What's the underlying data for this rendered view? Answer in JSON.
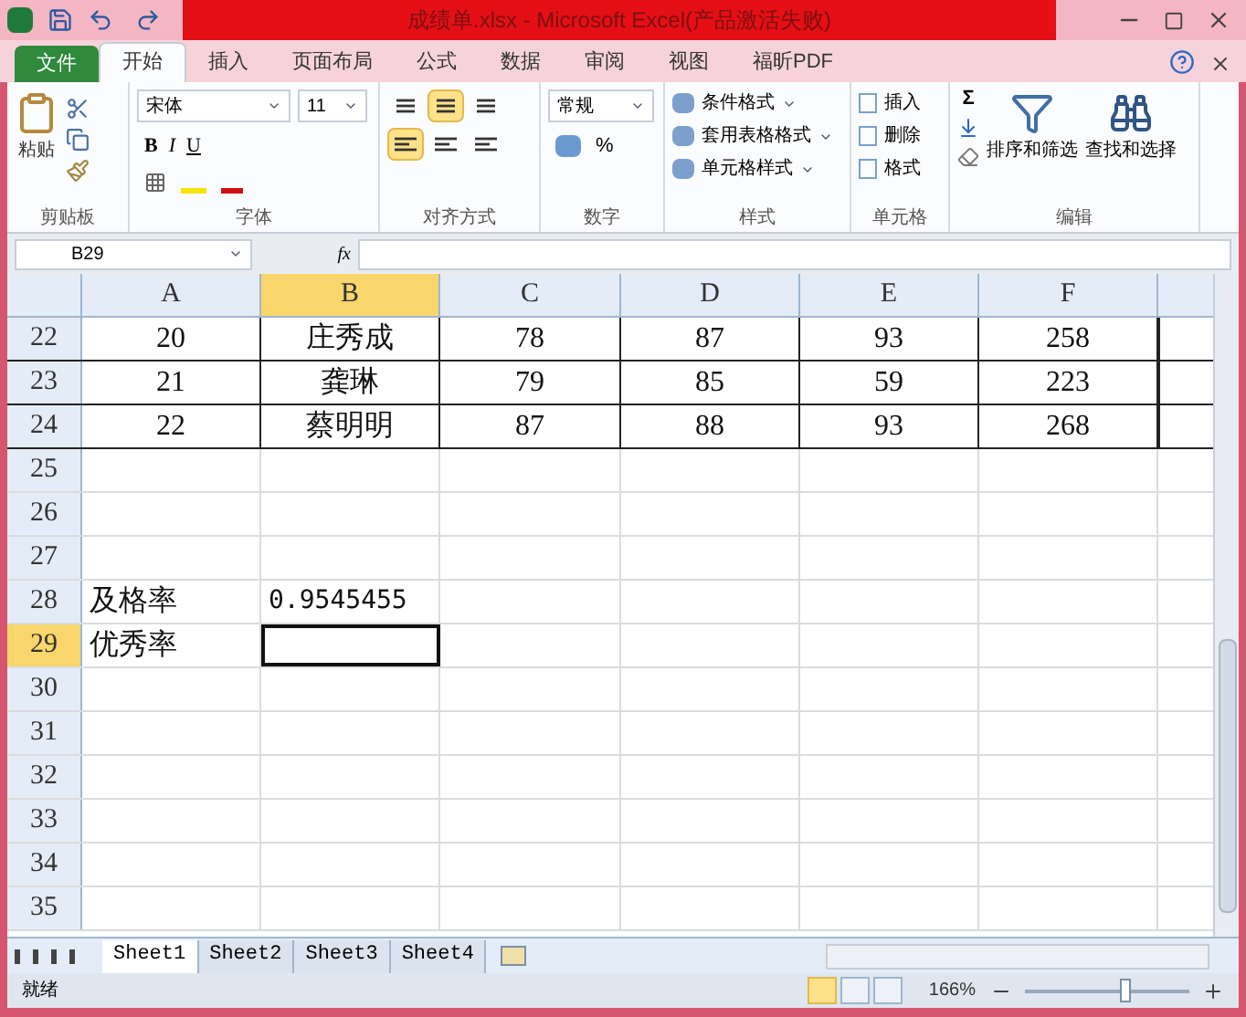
{
  "window": {
    "title": "成绩单.xlsx - Microsoft Excel(产品激活失败)"
  },
  "file_tab": "文件",
  "tabs": [
    {
      "label": "开始",
      "selected": true
    },
    {
      "label": "插入",
      "selected": false
    },
    {
      "label": "页面布局",
      "selected": false
    },
    {
      "label": "公式",
      "selected": false
    },
    {
      "label": "数据",
      "selected": false
    },
    {
      "label": "审阅",
      "selected": false
    },
    {
      "label": "视图",
      "selected": false
    },
    {
      "label": "福昕PDF",
      "selected": false
    }
  ],
  "ribbon": {
    "clipboard": {
      "label": "剪贴板",
      "paste": "粘贴"
    },
    "font": {
      "label": "字体",
      "font_name": "宋体",
      "font_size": "11",
      "bold": "B",
      "italic": "I",
      "underline": "U"
    },
    "alignment": {
      "label": "对齐方式",
      "vertical": [
        {
          "selected": false
        },
        {
          "selected": true
        },
        {
          "selected": false
        }
      ],
      "horizontal": [
        {
          "selected": true
        },
        {
          "selected": false
        },
        {
          "selected": false
        }
      ]
    },
    "number": {
      "label": "数字",
      "format": "常规",
      "percent": "%"
    },
    "styles": {
      "label": "样式",
      "items": [
        "条件格式",
        "套用表格格式",
        "单元格样式"
      ]
    },
    "cells": {
      "label": "单元格",
      "items": [
        "插入",
        "删除",
        "格式"
      ]
    },
    "editing": {
      "label": "编辑",
      "sum": "Σ",
      "items": [
        "排序和筛选",
        "查找和选择"
      ]
    }
  },
  "formula_bar": {
    "name_box": "B29",
    "fx": "fx"
  },
  "columns": [
    {
      "label": "A",
      "selected": false
    },
    {
      "label": "B",
      "selected": true
    },
    {
      "label": "C",
      "selected": false
    },
    {
      "label": "D",
      "selected": false
    },
    {
      "label": "E",
      "selected": false
    },
    {
      "label": "F",
      "selected": false
    }
  ],
  "rows": [
    {
      "number": "22",
      "selected": false,
      "kind": "table",
      "cells": [
        "20",
        "庄秀成",
        "78",
        "87",
        "93",
        "258"
      ]
    },
    {
      "number": "23",
      "selected": false,
      "kind": "table",
      "cells": [
        "21",
        "龚琳",
        "79",
        "85",
        "59",
        "223"
      ]
    },
    {
      "number": "24",
      "selected": false,
      "kind": "table",
      "cells": [
        "22",
        "蔡明明",
        "87",
        "88",
        "93",
        "268"
      ]
    },
    {
      "number": "25",
      "selected": false,
      "kind": "text",
      "cells": []
    },
    {
      "number": "26",
      "selected": false,
      "kind": "text",
      "cells": []
    },
    {
      "number": "27",
      "selected": false,
      "kind": "text",
      "cells": []
    },
    {
      "number": "28",
      "selected": false,
      "kind": "text",
      "cells": [
        "及格率",
        "0.9545455"
      ]
    },
    {
      "number": "29",
      "selected": true,
      "kind": "text",
      "cells": [
        "优秀率"
      ]
    },
    {
      "number": "30",
      "selected": false,
      "kind": "text",
      "cells": []
    },
    {
      "number": "31",
      "selected": false,
      "kind": "text",
      "cells": []
    },
    {
      "number": "32",
      "selected": false,
      "kind": "text",
      "cells": []
    },
    {
      "number": "33",
      "selected": false,
      "kind": "text",
      "cells": []
    },
    {
      "number": "34",
      "selected": false,
      "kind": "text",
      "cells": []
    },
    {
      "number": "35",
      "selected": false,
      "kind": "text",
      "cells": []
    }
  ],
  "sheets": [
    {
      "label": "Sheet1",
      "selected": true
    },
    {
      "label": "Sheet2",
      "selected": false
    },
    {
      "label": "Sheet3",
      "selected": false
    },
    {
      "label": "Sheet4",
      "selected": false
    }
  ],
  "status_bar": {
    "status": "就绪",
    "views": [
      {
        "selected": true
      },
      {
        "selected": false
      },
      {
        "selected": false
      }
    ],
    "zoom": "166%",
    "zoom_slider": {
      "level": 0.6
    }
  }
}
